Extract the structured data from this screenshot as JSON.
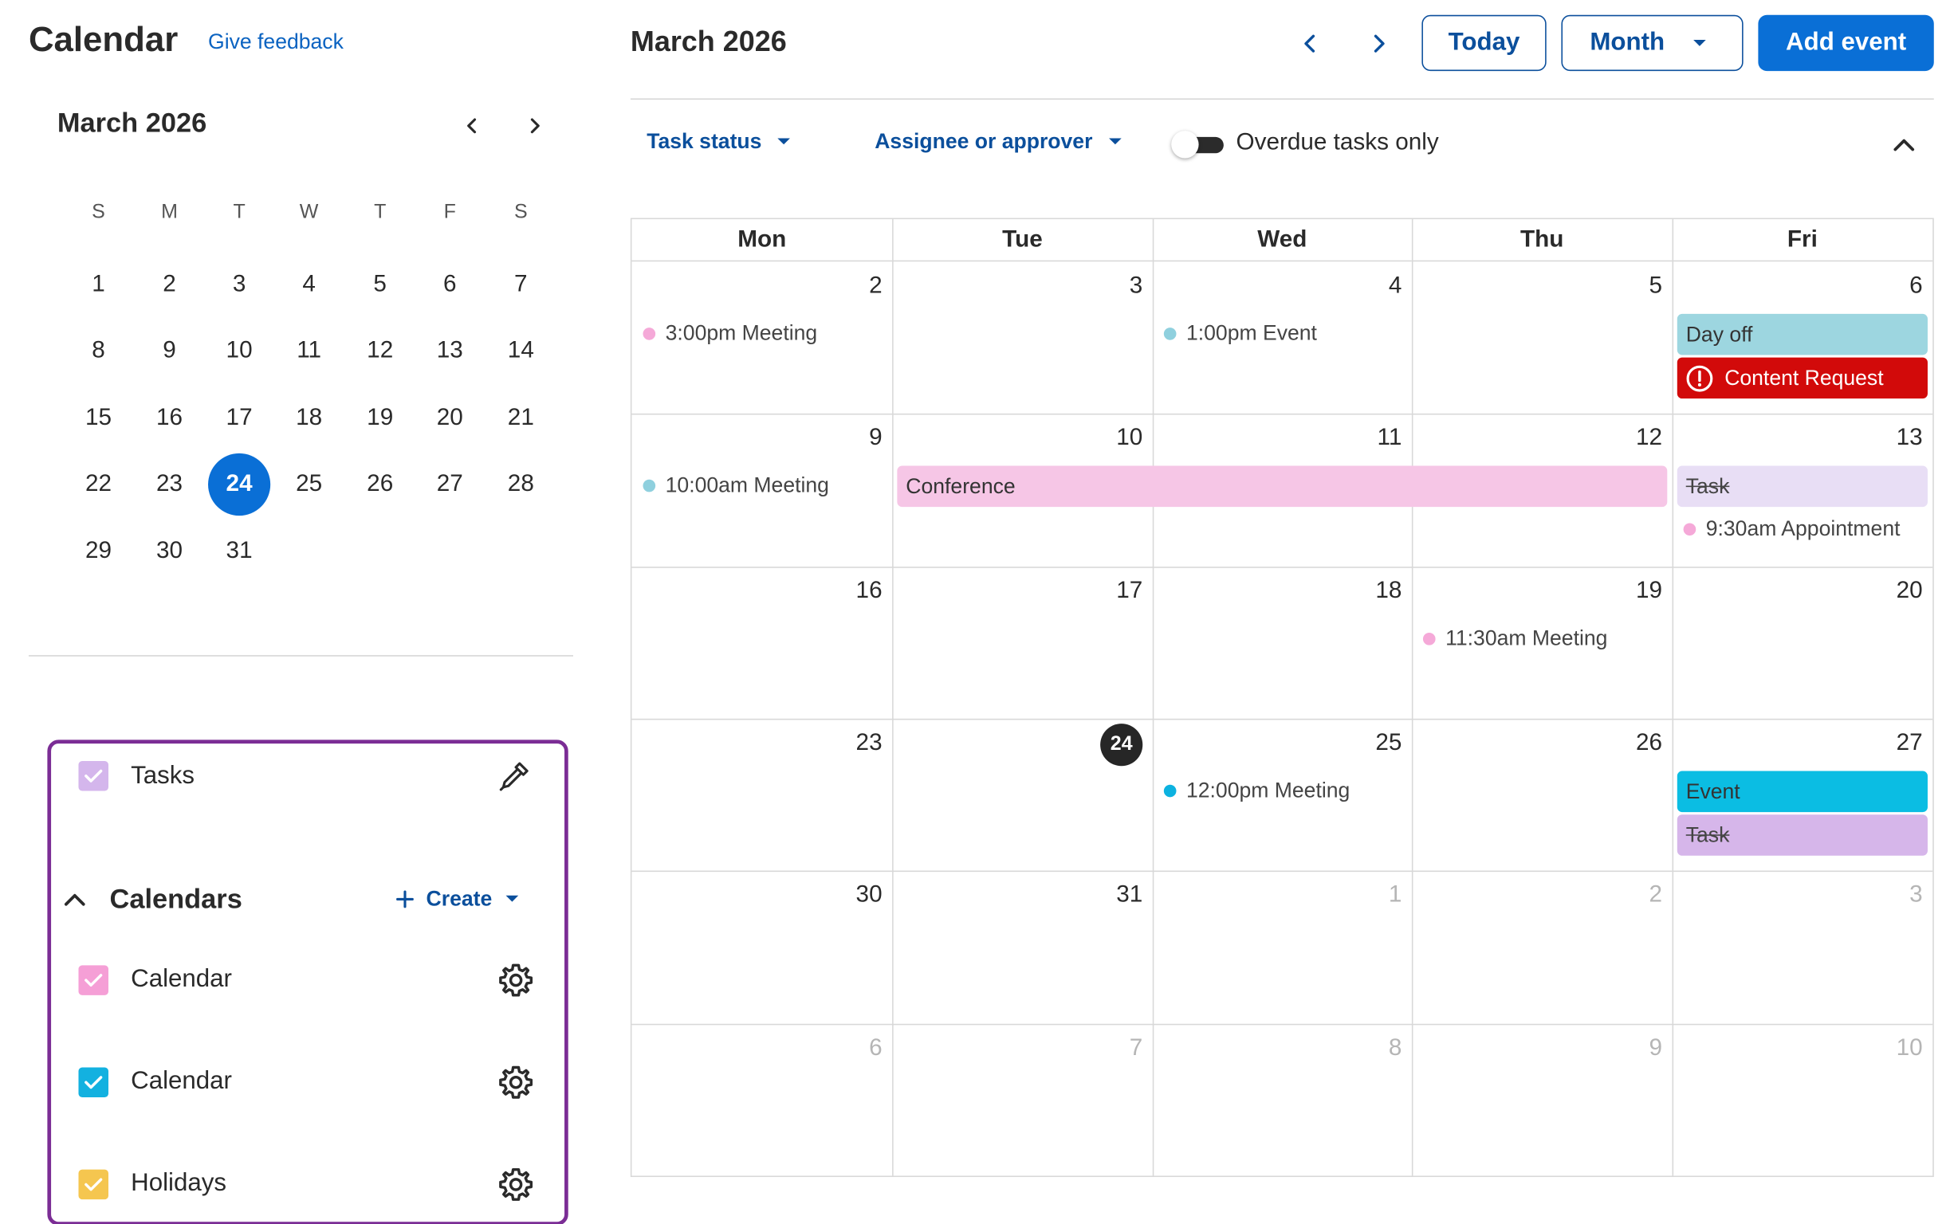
{
  "header": {
    "app_title": "Calendar",
    "feedback": "Give feedback",
    "month_title": "March 2026",
    "today_label": "Today",
    "view_label": "Month",
    "add_event_label": "Add event"
  },
  "filters": {
    "task_status": "Task status",
    "assignee": "Assignee or approver",
    "overdue_label": "Overdue tasks only"
  },
  "mini_calendar": {
    "title": "March 2026",
    "weekdays": [
      "S",
      "M",
      "T",
      "W",
      "T",
      "F",
      "S"
    ],
    "weeks": [
      [
        "1",
        "2",
        "3",
        "4",
        "5",
        "6",
        "7"
      ],
      [
        "8",
        "9",
        "10",
        "11",
        "12",
        "13",
        "14"
      ],
      [
        "15",
        "16",
        "17",
        "18",
        "19",
        "20",
        "21"
      ],
      [
        "22",
        "23",
        "24",
        "25",
        "26",
        "27",
        "28"
      ],
      [
        "29",
        "30",
        "31",
        "",
        "",
        "",
        ""
      ]
    ],
    "today": "24"
  },
  "sidebar": {
    "tasks_label": "Tasks",
    "calendars_heading": "Calendars",
    "create_label": "Create",
    "calendars": [
      {
        "label": "Calendar",
        "color": "#f59fd6"
      },
      {
        "label": "Calendar",
        "color": "#13b1e0"
      },
      {
        "label": "Holidays",
        "color": "#f5c64f"
      }
    ],
    "tasks_color": "#d4b6ec"
  },
  "grid": {
    "columns": [
      "Mon",
      "Tue",
      "Wed",
      "Thu",
      "Fri"
    ],
    "weeks": [
      [
        {
          "d": "2"
        },
        {
          "d": "3"
        },
        {
          "d": "4"
        },
        {
          "d": "5"
        },
        {
          "d": "6"
        }
      ],
      [
        {
          "d": "9"
        },
        {
          "d": "10"
        },
        {
          "d": "11"
        },
        {
          "d": "12"
        },
        {
          "d": "13"
        }
      ],
      [
        {
          "d": "16"
        },
        {
          "d": "17"
        },
        {
          "d": "18"
        },
        {
          "d": "19"
        },
        {
          "d": "20"
        }
      ],
      [
        {
          "d": "23"
        },
        {
          "d": "24",
          "today": true
        },
        {
          "d": "25"
        },
        {
          "d": "26"
        },
        {
          "d": "27"
        }
      ],
      [
        {
          "d": "30"
        },
        {
          "d": "31"
        },
        {
          "d": "1",
          "out": true
        },
        {
          "d": "2",
          "out": true
        },
        {
          "d": "3",
          "out": true
        }
      ],
      [
        {
          "d": "6",
          "out": true
        },
        {
          "d": "7",
          "out": true
        },
        {
          "d": "8",
          "out": true
        },
        {
          "d": "9",
          "out": true
        },
        {
          "d": "10",
          "out": true
        }
      ]
    ]
  },
  "events": [
    {
      "week": 0,
      "col": 0,
      "slot": 0,
      "kind": "dot",
      "label": "3:00pm Meeting",
      "color": "#f5a9d8"
    },
    {
      "week": 0,
      "col": 2,
      "slot": 0,
      "kind": "dot",
      "label": "1:00pm Event",
      "color": "#8fd0de"
    },
    {
      "week": 0,
      "col": 4,
      "slot": 0,
      "kind": "bar",
      "label": "Day off",
      "color": "#9dd6e0"
    },
    {
      "week": 0,
      "col": 4,
      "slot": 1,
      "kind": "alert",
      "label": "Content Request",
      "color": "#d20a0a"
    },
    {
      "week": 1,
      "col": 0,
      "slot": 0,
      "kind": "dot",
      "label": "10:00am Meeting",
      "color": "#8fd0de"
    },
    {
      "week": 1,
      "col": 1,
      "span": 3,
      "slot": 0,
      "kind": "bar",
      "label": "Conference",
      "color": "#f6c6e6"
    },
    {
      "week": 1,
      "col": 4,
      "slot": 0,
      "kind": "strike",
      "label": "Task",
      "color": "#e8def5"
    },
    {
      "week": 1,
      "col": 4,
      "slot": 1,
      "kind": "dot",
      "label": "9:30am Appointment",
      "color": "#f5a9d8"
    },
    {
      "week": 2,
      "col": 3,
      "slot": 0,
      "kind": "dot",
      "label": "11:30am Meeting",
      "color": "#f5a9d8"
    },
    {
      "week": 3,
      "col": 2,
      "slot": 0,
      "kind": "dot",
      "label": "12:00pm Meeting",
      "color": "#0cb2e0"
    },
    {
      "week": 3,
      "col": 4,
      "slot": 0,
      "kind": "bar",
      "label": "Event",
      "color": "#0bbde3"
    },
    {
      "week": 3,
      "col": 4,
      "slot": 1,
      "kind": "strike",
      "label": "Task",
      "color": "#d6b6ea"
    }
  ]
}
